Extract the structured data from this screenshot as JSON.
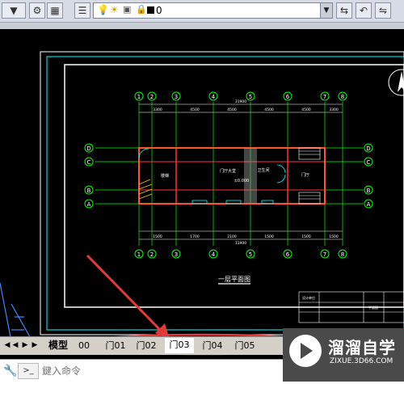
{
  "toolbar": {
    "layer_value": "0",
    "icons": [
      "gear-icon",
      "layer-state-icon",
      "layer-manager-icon",
      "lightbulb-icon",
      "sun-icon",
      "lock-icon",
      "color-swatch-icon",
      "layer-match-icon",
      "layer-previous-icon",
      "layer-states-icon"
    ]
  },
  "drawing": {
    "col_top": [
      "1",
      "2",
      "3",
      "4",
      "5",
      "6",
      "7",
      "8"
    ],
    "row_left": [
      "D",
      "C",
      "B",
      "A"
    ],
    "row_right": [
      "D",
      "C",
      "B",
      "A"
    ],
    "dim_total": "31900",
    "dim_segments": [
      "3300",
      "4500",
      "4500",
      "4500",
      "4500",
      "3300"
    ],
    "sub_dims": [
      "1500",
      "1700",
      "2100",
      "1500",
      "1500",
      "1500",
      "2400",
      "1800"
    ],
    "room_label_1": "楼梯",
    "room_label_2": "门厅大堂",
    "room_label_3": "卫生间",
    "room_label_4": "门厅",
    "dimension_text": "±0.000",
    "title": "一层平面图",
    "titleblock_name": "平面图",
    "titleblock_left": "设计单位",
    "compass": "N"
  },
  "tabs": {
    "model": "模型",
    "layouts": [
      "00",
      "门01",
      "门02",
      "门03",
      "门04",
      "门05"
    ],
    "active": "门03"
  },
  "command": {
    "placeholder": "鍵入命令"
  },
  "watermark": {
    "name": "溜溜自学",
    "url": "ZIXUE.3D66.COM"
  },
  "colors": {
    "axis": "#00ff00",
    "wall": "#ff3333",
    "dim": "#ffffff",
    "bubble": "#00ff00",
    "annotation_arrow": "#e53935"
  }
}
